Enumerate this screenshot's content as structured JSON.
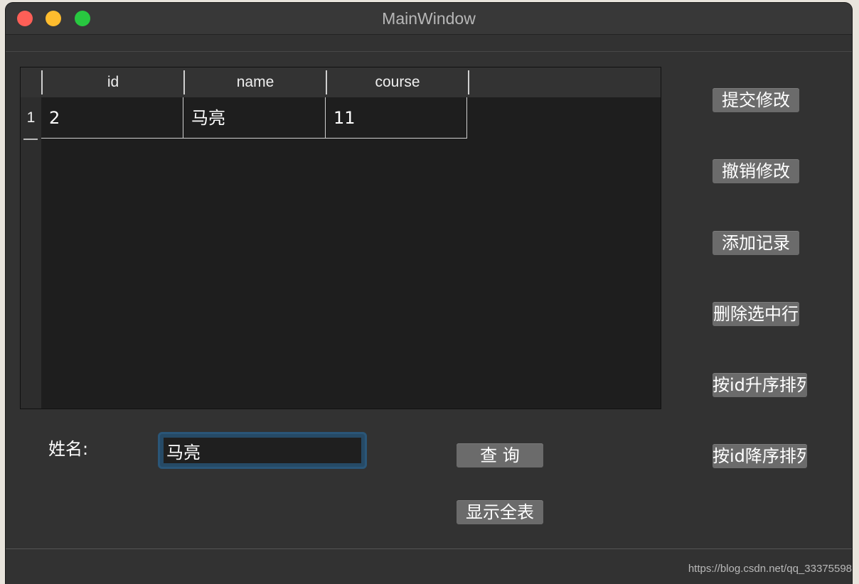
{
  "window": {
    "title": "MainWindow"
  },
  "table": {
    "columns": [
      "id",
      "name",
      "course"
    ],
    "rows": [
      {
        "row_label": "1",
        "cells": [
          "2",
          "马亮",
          "11"
        ]
      }
    ]
  },
  "side_buttons": {
    "submit": "提交修改",
    "revert": "撤销修改",
    "add": "添加记录",
    "delete": "删除选中行",
    "sort_asc": "按id升序排列",
    "sort_desc": "按id降序排列"
  },
  "search": {
    "label": "姓名:",
    "value": "马亮",
    "query_button": "查 询",
    "show_all_button": "显示全表"
  },
  "watermark": "https://blog.csdn.net/qq_33375598",
  "colors": {
    "window_bg": "#323232",
    "table_bg": "#1e1e1e",
    "button_bg": "#6b6b6b",
    "focus_ring": "#2a5678"
  }
}
